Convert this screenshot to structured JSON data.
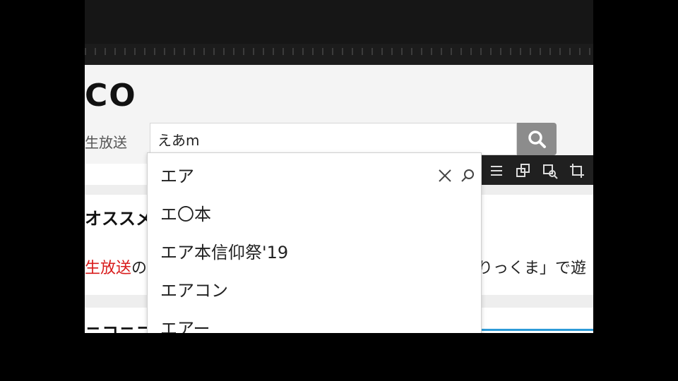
{
  "site": {
    "logo_text": "CO"
  },
  "nav": {
    "live_label": "生放送"
  },
  "search": {
    "value": "えあm"
  },
  "suggestions": [
    "エア",
    "エ〇本",
    "エア本信仰祭'19",
    "エアコン",
    "エアー"
  ],
  "content": {
    "section_title": "オススメ",
    "live_text_red": "生放送",
    "live_text_rest": "の",
    "right_text": "りっくま」で遊",
    "bottom_title": "ニコニコ"
  },
  "icons": {
    "search_button": "search-icon",
    "clear": "close-icon",
    "suggest_search": "magnifier-icon",
    "toolbar": [
      "list-icon",
      "copy-icon",
      "playlist-icon",
      "crop-icon"
    ]
  },
  "colors": {
    "search_button_bg": "#8c8c8c",
    "live_red": "#d81b1b",
    "toolbar_bg": "#202020"
  }
}
